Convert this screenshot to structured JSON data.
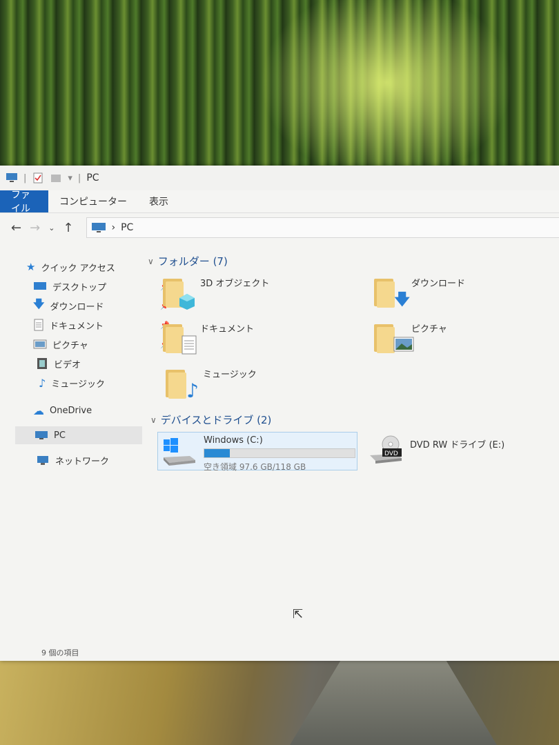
{
  "titlebar": {
    "title": "PC"
  },
  "ribbon": {
    "tabs": [
      "ファイル",
      "コンピューター",
      "表示"
    ]
  },
  "address": {
    "path": "PC"
  },
  "sidebar": {
    "quick_access": "クイック アクセス",
    "items": [
      "デスクトップ",
      "ダウンロード",
      "ドキュメント",
      "ピクチャ",
      "ビデオ",
      "ミュージック"
    ],
    "onedrive": "OneDrive",
    "pc": "PC",
    "network": "ネットワーク"
  },
  "content": {
    "folders_header": "フォルダー (7)",
    "folders": [
      "3D オブジェクト",
      "ダウンロード",
      "ドキュメント",
      "ピクチャ",
      "ミュージック"
    ],
    "devices_header": "デバイスとドライブ (2)",
    "drive_c": {
      "name": "Windows (C:)",
      "free": "空き領域 97.6 GB/118 GB",
      "used_fraction": 0.17
    },
    "drive_e": {
      "name": "DVD RW ドライブ (E:)"
    }
  },
  "status": {
    "text": "9 個の項目"
  }
}
